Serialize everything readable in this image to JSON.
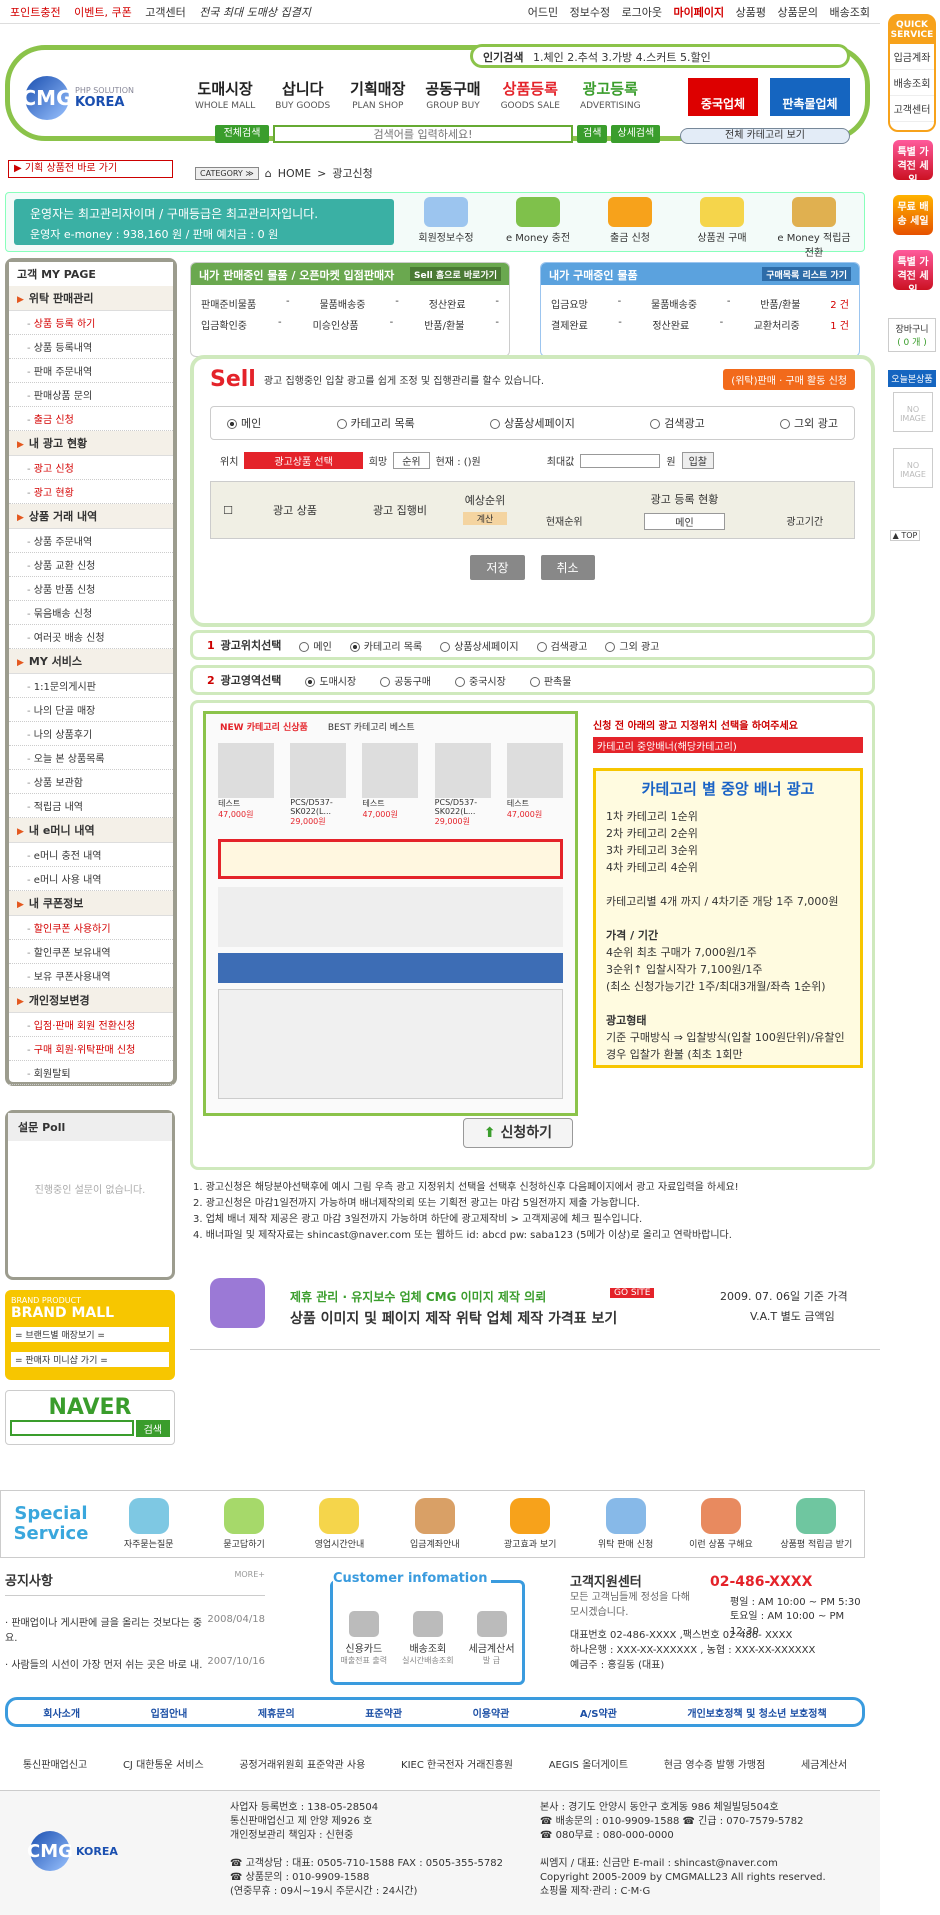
{
  "topbar": {
    "left": [
      "포인트충전",
      "이벤트, 쿠폰",
      "고객센터"
    ],
    "tagline": "전국 최대 도매상 집결지",
    "right": [
      "어드민",
      "정보수정",
      "로그아웃",
      "마이페이지",
      "상품평",
      "상품문의",
      "배송조회"
    ]
  },
  "logo": {
    "text": "CMG",
    "sub": "KOREA",
    "small": "PHP SOLUTION"
  },
  "nav": [
    {
      "k": "도매시장",
      "e": "WHOLE MALL"
    },
    {
      "k": "삽니다",
      "e": "BUY GOODS"
    },
    {
      "k": "기획매장",
      "e": "PLAN SHOP"
    },
    {
      "k": "공동구매",
      "e": "GROUP BUY"
    },
    {
      "k": "상품등록",
      "e": "GOODS SALE"
    },
    {
      "k": "광고등록",
      "e": "ADVERTISING"
    }
  ],
  "popular": {
    "label": "인기검색",
    "items": "1.체인  2.추석  3.가방  4.스커트  5.할인"
  },
  "search": {
    "scope": "전체검색",
    "placeholder": "검색어를 입력하세요!",
    "btn": "검색",
    "btn2": "상세검색",
    "all_cat": "전체 카테고리 보기"
  },
  "promo": {
    "china": "중국업체",
    "sale": "판촉물업체"
  },
  "quick": {
    "title": "QUICK SERVICE",
    "items": [
      "입금계좌",
      "배송조회",
      "고객센터"
    ],
    "sale": [
      "특별 가격전 세일",
      "무료 배송 세일",
      "특별 가격전 세일"
    ],
    "cart": "장바구니",
    "cart_count": "( 0 개 )",
    "today": "오늘본상품",
    "noimg": "NO IMAGE",
    "top": "▲ TOP"
  },
  "gobar": "▶ 기획 상품전 바로 가기",
  "breadcrumb": {
    "cat": "CATEGORY ≫",
    "home": "HOME",
    "page": "광고신청"
  },
  "operator": {
    "line1": "운영자는 최고관리자이며 / 구매등급은 최고관리자입니다.",
    "line2": "운영자 e-money : 938,160 원 / 판매 예치금 : 0 원",
    "acts": [
      "회원정보수정",
      "e Money 충전",
      "출금 신청",
      "상품권 구매",
      "e Money 적립금 전환"
    ]
  },
  "mypage": {
    "title": "고객 MY PAGE",
    "sections": [
      {
        "name": "위탁 판매관리",
        "items": [
          "상품 등록 하기",
          "상품 등록내역",
          "판매 주문내역",
          "판매상품 문의",
          "출금 신청"
        ]
      },
      {
        "name": "내 광고 현황",
        "items": [
          "광고 신청",
          "광고 현황"
        ]
      },
      {
        "name": "상품 거래 내역",
        "items": [
          "상품 주문내역",
          "상품 교환 신청",
          "상품 반품 신청",
          "묶음배송 신청",
          "여러곳 배송 신청"
        ]
      },
      {
        "name": "MY 서비스",
        "items": [
          "1:1문의게시판",
          "나의 단골 매장",
          "나의 상품후기",
          "오늘 본 상품목록",
          "상품 보관함",
          "적립금 내역"
        ]
      },
      {
        "name": "내 e머니 내역",
        "items": [
          "e머니 충전 내역",
          "e머니 사용 내역"
        ]
      },
      {
        "name": "내 쿠폰정보",
        "items": [
          "할인쿠폰 사용하기",
          "할인쿠폰 보유내역",
          "보유 쿠폰사용내역"
        ]
      },
      {
        "name": "개인정보변경",
        "items": [
          "입점·판매 회원 전환신청",
          "구매 회원·위탁판매 신청",
          "회원탈퇴"
        ]
      }
    ]
  },
  "poll": {
    "title": "설문 Poll",
    "empty": "진행중인 설문이 없습니다."
  },
  "brandmall": {
    "sub": "BRAND PRODUCT",
    "title": "BRAND MALL",
    "sel1": "= 브랜드별 매장보기 =",
    "sel2": "= 판매자 미니샵 가기 ="
  },
  "naver": {
    "name": "NAVER",
    "btn": "검색"
  },
  "sellbox": {
    "title": "Sell",
    "desc": "광고 집행중인 입찰 광고를 쉽게 조정 및 집행관리를 할수 있습니다.",
    "apply": "(위탁)판매 · 구매 활동 신청",
    "radios": [
      "메인",
      "카테고리 목록",
      "상품상세페이지",
      "검색광고",
      "그외 광고"
    ],
    "pos_label": "위치",
    "pos_value": "광고상품 선택",
    "want": "희망",
    "rank": "순위",
    "current": "현재 : ()원",
    "max": "최대값",
    "won": "원",
    "bid": "입찰",
    "th": [
      "광고 상품",
      "광고 집행비",
      "예상순위",
      "광고 등록 현황",
      "현재순위",
      "광고기간"
    ],
    "calc": "계산",
    "main_opt": "메인",
    "save": "저장",
    "cancel": "취소"
  },
  "buysell": {
    "sell_title": "내가 판매중인 물품 / 오픈마켓 입점판매자",
    "sell_btn": "Sell 홈으로 바로가기",
    "sell_rows": [
      [
        "판매준비물품",
        "-",
        "물품배송중",
        "-",
        "정산완료",
        "-"
      ],
      [
        "입금확인중",
        "-",
        "미승인상품",
        "-",
        "반품/환불",
        "-"
      ]
    ],
    "buy_title": "내가 구매중인 물품",
    "buy_btn": "구매목록 리스트 가기",
    "buy_rows": [
      [
        "입금요망",
        "-",
        "물품배송중",
        "-",
        "반품/환불",
        "2 건"
      ],
      [
        "결제완료",
        "-",
        "정산완료",
        "-",
        "교환처리중",
        "1 건"
      ]
    ]
  },
  "select1": {
    "label": "광고위치선택",
    "opts": [
      "메인",
      "카테고리 목록",
      "상품상세페이지",
      "검색광고",
      "그외 광고"
    ]
  },
  "select2": {
    "label": "광고영역선택",
    "opts": [
      "도매시장",
      "공동구매",
      "중국시장",
      "판촉물"
    ]
  },
  "preview": {
    "note": "신청 전 아래의 광고 지정위치 선택을 하여주세요",
    "dropdown": "카테고리 중앙배너(해당카테고리)",
    "title": "카테고리 별 중앙 배너 광고",
    "lines": [
      "1차 카테고리 1순위",
      "2차 카테고리 2순위",
      "3차 카테고리 3순위",
      "4차 카테고리 4순위",
      "",
      "카테고리별 4개 까지  / 4차기준 개당 1주 7,000원",
      "",
      "가격 / 기간",
      "4순위 최초 구매가 7,000원/1주",
      "3순위↑ 입찰시작가 7,100원/1주",
      "(최소 신청가능기간 1주/최대3개월/좌측 1순위)",
      "",
      "광고형태",
      "기준 구매방식 ⇒ 입찰방식(입찰 100원단위)/유찰인경우 입찰가 환불 (최초 1회만"
    ],
    "tabs": [
      "NEW 카테고리 신상품",
      "BEST 카테고리 베스트"
    ],
    "products": [
      "테스트",
      "PCS/D537-SK022(L...",
      "테스트",
      "PCS/D537-SK022(L...",
      "테스트"
    ],
    "prices": [
      "47,000원",
      "29,000원",
      "47,000원",
      "29,000원",
      "47,000원"
    ],
    "apply": "신청하기"
  },
  "notes": [
    "1. 광고신청은 해당분야선택후에 예시 그림 우측 광고 지정위치 선택을 선택후 신청하신후 다음페이지에서 광고 자료입력을 하세요!",
    "2. 광고신청은 마감1일전까지 가능하며 배너제작의뢰 또는 기획전 광고는 마감 5일전까지 제출 가능합니다.",
    "3. 업체 배너 제작 제공은 광고 마감 3일전까지 가능하며 하단에 광고제작비 > 고객제공에 체크 필수입니다.",
    "4. 배너파일 및 제작자료는 shincast@naver.com 또는 웹하드 id: abcd pw: saba123 (5메가 이상)로 올리고 연락바랍니다."
  ],
  "design": {
    "l1": "제휴 관리 · 유지보수 업체 CMG 이미지 제작 의뢰",
    "go": "GO SITE",
    "l2": "상품 이미지 및 페이지 제작 위탁 업체 제작 가격표 보기",
    "date": "2009. 07. 06일 기준 가격",
    "vat": "V.A.T 별도 금액임"
  },
  "special": {
    "title": "Special Service",
    "items": [
      "자주묻는질문",
      "묻고답하기",
      "영업시간안내",
      "입금계좌안내",
      "광고효과 보기",
      "위탁 판매 신청",
      "이런 상품 구해요",
      "상품평 적립금 받기"
    ]
  },
  "notice": {
    "title": "공지사항",
    "more": "MORE+",
    "items": [
      [
        "판매업이나 게시판에 글을 올리는 것보다는 중요.",
        "2008/04/18"
      ],
      [
        "사람들의 시선이 가장 먼저 쉬는 곳은 바로 내.",
        "2007/10/16"
      ]
    ]
  },
  "custinfo": {
    "title": "Customer infomation",
    "items": [
      [
        "신용카드",
        "매출전표 출력"
      ],
      [
        "배송조회",
        "실시간배송조회"
      ],
      [
        "세금계산서",
        "발 급"
      ]
    ]
  },
  "center": {
    "title": "고객지원센터",
    "desc": "모든 고객님들께 정성을 다해 모시겠습니다.",
    "phone": "02-486-XXXX",
    "hours": [
      "평일 : AM 10:00 ~ PM 5:30",
      "토요일 : AM 10:00 ~ PM 12:30"
    ],
    "bank": "대표번호 02-486-XXXX ,팩스번호 02-486- XXXX",
    "acc1": "하나은행 : XXX-XX-XXXXXX  , 농협 : XXX-XX-XXXXXX",
    "holder": "예금주 : 홍길동 (대표)"
  },
  "links": [
    "회사소개",
    "입점안내",
    "제휴문의",
    "표준약관",
    "이용약관",
    "A/S약관",
    "개인보호정책 및 청소년 보호정책"
  ],
  "partners": [
    "통신판매업신고",
    "CJ 대한통운 서비스",
    "공정거래위원회 표준약관 사용",
    "KIEC 한국전자 거래진흥원",
    "AEGIS 올더게이트",
    "현금 영수증 발행 가맹점",
    "세금계산서"
  ],
  "footer": {
    "left": [
      "사업자 등록번호 : 138-05-28504",
      "통신판매업신고 제 안양 제926 호",
      "개인정보관리 책임자 : 신현중",
      "",
      "☎ 고객상담 : 대표: 0505-710-1588  FAX : 0505-355-5782",
      "☎ 상품문의 : 010-9909-1588",
      "(연중무휴 : 09시~19시 주문시간 : 24시간)"
    ],
    "right": [
      "본사 : 경기도 안양시 동안구 호계동 986 체일빌딩504호",
      "☎ 배송문의 : 010-9909-1588 ☎ 긴급 : 070-7579-5782",
      "☎ 080무료 : 080-000-0000",
      "",
      "씨엠지 / 대표: 신금만  E-mail : shincast@naver.com",
      "Copyright 2005-2009 by CMGMALL23 All rights reserved.",
      "쇼핑몰 제작·관리 : C·M·G"
    ]
  }
}
